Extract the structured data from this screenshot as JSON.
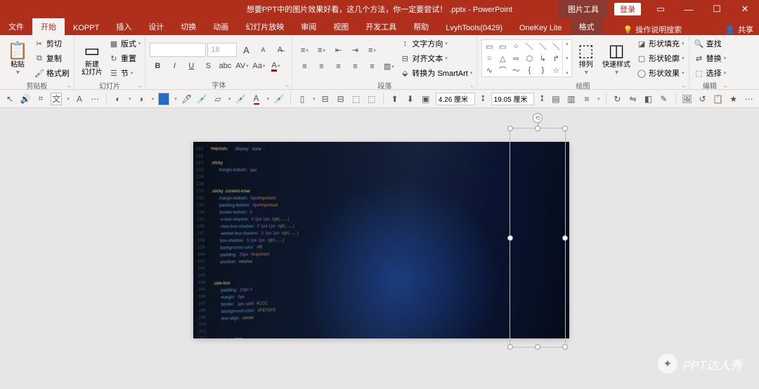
{
  "titlebar": {
    "doc_title": "想要PPT中的图片效果好看，这几个方法，你一定要尝试！ .pptx - PowerPoint",
    "contextual_tool": "图片工具",
    "login": "登录"
  },
  "tabs": {
    "file": "文件",
    "items": [
      "开始",
      "KOPPT",
      "插入",
      "设计",
      "切换",
      "动画",
      "幻灯片放映",
      "审阅",
      "视图",
      "开发工具",
      "帮助",
      "LvyhTools(0429)",
      "OneKey Lite"
    ],
    "contextual": "格式",
    "active": "开始",
    "tell_me_placeholder": "操作说明搜索",
    "share": "共享"
  },
  "ribbon": {
    "clipboard": {
      "label": "剪贴板",
      "paste": "粘贴",
      "cut": "剪切",
      "copy": "复制",
      "format_painter": "格式刷"
    },
    "slides": {
      "label": "幻灯片",
      "new": "新建\n幻灯片",
      "layout": "版式",
      "reset": "重置",
      "section": "节"
    },
    "font": {
      "label": "字体",
      "font_name": "",
      "font_size": "16",
      "grow": "A",
      "shrink": "A",
      "clear": "Aₓ"
    },
    "paragraph": {
      "label": "段落",
      "text_direction": "文字方向",
      "align_text": "对齐文本",
      "smartart": "转换为 SmartArt"
    },
    "drawing": {
      "label": "绘图",
      "arrange": "排列",
      "quick_styles": "快速样式",
      "shape_fill": "形状填充",
      "shape_outline": "形状轮廓",
      "shape_effects": "形状效果"
    },
    "editing": {
      "label": "编辑",
      "find": "查找",
      "replace": "替换",
      "select": "选择"
    }
  },
  "qat": {
    "height_label": "4.26 厘米",
    "width_label": "19.05 厘米"
  },
  "watermark": {
    "text": "PPT达人秀"
  }
}
